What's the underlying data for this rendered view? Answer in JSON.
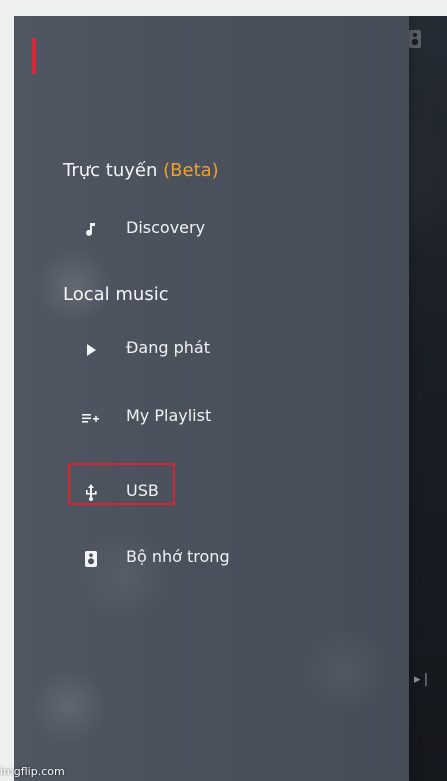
{
  "drawer": {
    "sections": {
      "online": {
        "title": "Trực tuyến",
        "badge": "(Beta)"
      },
      "local": {
        "title": "Local music"
      }
    },
    "items": [
      {
        "label": "Discovery",
        "icon": "music-note-icon"
      },
      {
        "label": "Đang phát",
        "icon": "play-icon"
      },
      {
        "label": "My Playlist",
        "icon": "playlist-add-icon"
      },
      {
        "label": "USB",
        "icon": "usb-icon"
      },
      {
        "label": "Bộ nhớ trong",
        "icon": "speaker-icon"
      }
    ],
    "highlighted_item": "USB"
  },
  "background_controls": {
    "top_right_icon": "speaker-icon",
    "bottom_right_icon": "skip-next-icon"
  },
  "watermark": {
    "text": "imgflip.com"
  },
  "colors": {
    "drawer_bg": "#4b525d",
    "accent": "#f0a02c",
    "highlight": "#d9232f",
    "marker": "#d8283b"
  }
}
